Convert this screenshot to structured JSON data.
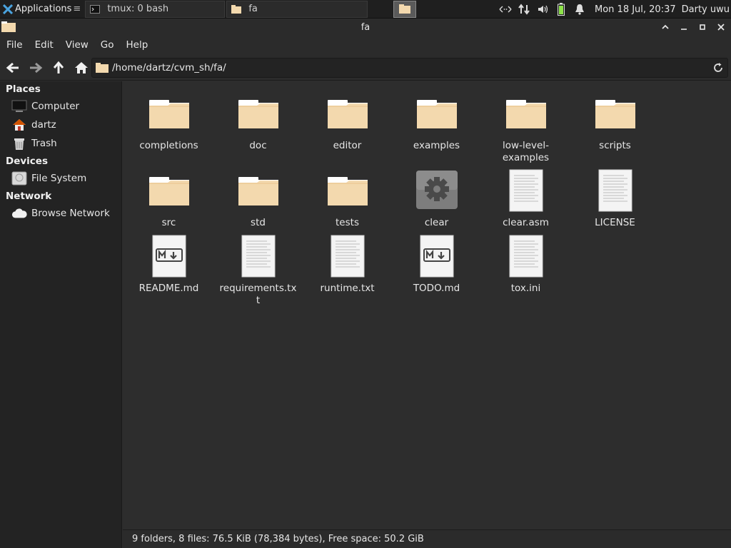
{
  "panel": {
    "applications_label": "Applications",
    "separator_glyph": "≡",
    "tasks": [
      {
        "label": "tmux: 0 bash"
      },
      {
        "label": "fa"
      }
    ],
    "clock": "Mon 18 Jul, 20:37",
    "user": "Darty uwu"
  },
  "window": {
    "title": "fa",
    "buttons": {
      "maximize": "˄",
      "minimize": "–",
      "restore": "□",
      "close": "✕"
    }
  },
  "menu": {
    "items": [
      "File",
      "Edit",
      "View",
      "Go",
      "Help"
    ]
  },
  "toolbar": {
    "path": "/home/dartz/cvm_sh/fa/"
  },
  "sidebar": {
    "sections": [
      {
        "title": "Places",
        "items": [
          {
            "label": "Computer",
            "icon": "computer-icon"
          },
          {
            "label": "dartz",
            "icon": "home-icon"
          },
          {
            "label": "Trash",
            "icon": "trash-icon"
          }
        ]
      },
      {
        "title": "Devices",
        "items": [
          {
            "label": "File System",
            "icon": "drive-icon"
          }
        ]
      },
      {
        "title": "Network",
        "items": [
          {
            "label": "Browse Network",
            "icon": "cloud-icon"
          }
        ]
      }
    ]
  },
  "files": [
    {
      "name": "completions",
      "type": "folder"
    },
    {
      "name": "doc",
      "type": "folder"
    },
    {
      "name": "editor",
      "type": "folder"
    },
    {
      "name": "examples",
      "type": "folder"
    },
    {
      "name": "low-level-examples",
      "type": "folder"
    },
    {
      "name": "scripts",
      "type": "folder"
    },
    {
      "name": "src",
      "type": "folder"
    },
    {
      "name": "std",
      "type": "folder"
    },
    {
      "name": "tests",
      "type": "folder"
    },
    {
      "name": "clear",
      "type": "executable"
    },
    {
      "name": "clear.asm",
      "type": "text"
    },
    {
      "name": "LICENSE",
      "type": "text"
    },
    {
      "name": "README.md",
      "type": "markdown"
    },
    {
      "name": "requirements.txt",
      "type": "text"
    },
    {
      "name": "runtime.txt",
      "type": "text"
    },
    {
      "name": "TODO.md",
      "type": "markdown"
    },
    {
      "name": "tox.ini",
      "type": "text"
    }
  ],
  "status": {
    "text": "9 folders, 8 files: 76.5 KiB (78,384 bytes), Free space: 50.2 GiB"
  },
  "colors": {
    "folder_fill": "#f3d9ae",
    "folder_tab": "#ffffff",
    "background": "#2d2d2d",
    "sidebar": "#232323",
    "battery": "#8ee34a"
  }
}
